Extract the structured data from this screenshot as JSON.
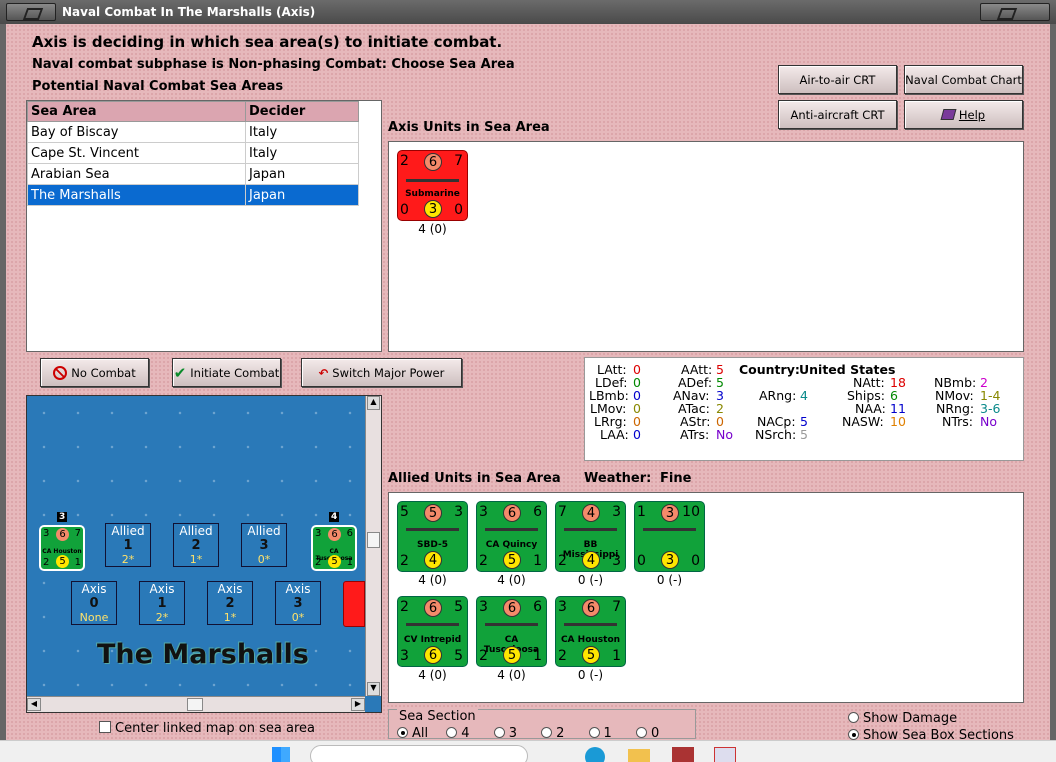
{
  "window": {
    "title": "Naval Combat In The Marshalls (Axis)"
  },
  "header": {
    "line1": "Axis is deciding in which sea area(s) to initiate combat.",
    "line2": "Naval combat subphase is Non-phasing Combat: Choose Sea Area",
    "line3": "Potential Naval Combat Sea Areas"
  },
  "buttons": {
    "air_to_air": "Air-to-air CRT",
    "naval_chart": "Naval Combat Chart",
    "anti_aircraft": "Anti-aircraft CRT",
    "help": "Help",
    "no_combat": "No Combat",
    "initiate": "Initiate Combat",
    "switch": "Switch Major Power"
  },
  "sea_table": {
    "headers": [
      "Sea Area",
      "Decider"
    ],
    "rows": [
      {
        "area": "Bay of Biscay",
        "decider": "Italy"
      },
      {
        "area": "Cape St. Vincent",
        "decider": "Italy"
      },
      {
        "area": "Arabian Sea",
        "decider": "Japan"
      },
      {
        "area": "The Marshalls",
        "decider": "Japan"
      }
    ]
  },
  "axis_units": {
    "label": "Axis Units in Sea Area",
    "sub": {
      "tl": "2",
      "tc": "6",
      "tr": "7",
      "name": "Submarine",
      "bl": "0",
      "bc": "3",
      "br": "0",
      "val": "4 (0)"
    }
  },
  "stats": {
    "country_label": "Country:",
    "country": "United States",
    "latt_l": "LAtt:",
    "latt": "0",
    "ldef_l": "LDef:",
    "ldef": "0",
    "lbmb_l": "LBmb:",
    "lbmb": "0",
    "lmov_l": "LMov:",
    "lmov": "0",
    "lrrg_l": "LRrg:",
    "lrrg": "0",
    "laa_l": "LAA:",
    "laa": "0",
    "aatt_l": "AAtt:",
    "aatt": "5",
    "adef_l": "ADef:",
    "adef": "5",
    "anav_l": "ANav:",
    "anav": "3",
    "atac_l": "ATac:",
    "atac": "2",
    "astr_l": "AStr:",
    "astr": "0",
    "atrs_l": "ATrs:",
    "atrs": "No",
    "arng_l": "ARng:",
    "arng": "4",
    "nacp_l": "NACp:",
    "nacp": "5",
    "nsrch_l": "NSrch:",
    "nsrch": "5",
    "natt_l": "NAtt:",
    "natt": "18",
    "ships_l": "Ships:",
    "ships": "6",
    "naa_l": "NAA:",
    "naa": "11",
    "nasw_l": "NASW:",
    "nasw": "10",
    "nbmb_l": "NBmb:",
    "nbmb": "2",
    "nmov_l": "NMov:",
    "nmov": "1-4",
    "nrng_l": "NRng:",
    "nrng": "3-6",
    "ntrs_l": "NTrs:",
    "ntrs": "No"
  },
  "allied": {
    "label": "Allied Units in Sea Area",
    "weather_label": "Weather:",
    "weather": "Fine",
    "units": [
      {
        "tl": "5",
        "tc": "5",
        "tr": "3",
        "name": "SBD-5",
        "bl": "2",
        "bc": "4",
        "br": "",
        "val": "4 (0)"
      },
      {
        "tl": "3",
        "tc": "6",
        "tr": "6",
        "name": "CA Quincy",
        "bl": "2",
        "bc": "5",
        "br": "1",
        "val": "4 (0)"
      },
      {
        "tl": "7",
        "tc": "4",
        "tr": "3",
        "name": "BB Mississippi",
        "bl": "2",
        "bc": "4",
        "br": "3",
        "val": "0 (-)"
      },
      {
        "tl": "1",
        "tc": "3",
        "tr": "10",
        "name": "",
        "bl": "0",
        "bc": "3",
        "br": "0",
        "val": "0 (-)"
      },
      {
        "tl": "2",
        "tc": "6",
        "tr": "5",
        "name": "CV Intrepid",
        "bl": "3",
        "bc": "6",
        "br": "5",
        "val": "4 (0)"
      },
      {
        "tl": "3",
        "tc": "6",
        "tr": "6",
        "name": "CA Tuscaloosa",
        "bl": "2",
        "bc": "5",
        "br": "1",
        "val": "4 (0)"
      },
      {
        "tl": "3",
        "tc": "6",
        "tr": "7",
        "name": "CA Houston",
        "bl": "2",
        "bc": "5",
        "br": "1",
        "val": "0 (-)"
      }
    ]
  },
  "map": {
    "name": "The Marshalls",
    "allied_boxes": [
      {
        "side": "Allied",
        "num": "1",
        "val": "2*"
      },
      {
        "side": "Allied",
        "num": "2",
        "val": "1*"
      },
      {
        "side": "Allied",
        "num": "3",
        "val": "0*"
      }
    ],
    "axis_boxes": [
      {
        "side": "Axis",
        "num": "0",
        "val": "None"
      },
      {
        "side": "Axis",
        "num": "1",
        "val": "2*"
      },
      {
        "side": "Axis",
        "num": "2",
        "val": "1*"
      },
      {
        "side": "Axis",
        "num": "3",
        "val": "0*"
      }
    ],
    "left_counter": {
      "tl": "3",
      "tc": "6",
      "tr": "7",
      "name": "CA Houston",
      "bl": "2",
      "bc": "5",
      "br": "1",
      "stack": "3"
    },
    "right_counter": {
      "tl": "3",
      "tc": "6",
      "tr": "6",
      "name": "CA Tuscaloosa",
      "bl": "2",
      "bc": "5",
      "br": "1",
      "stack": "4"
    }
  },
  "footer": {
    "center_map": "Center linked map on sea area",
    "sea_section": "Sea Section",
    "options": [
      "All",
      "4",
      "3",
      "2",
      "1",
      "0"
    ],
    "show_damage": "Show Damage",
    "show_sections": "Show Sea Box Sections"
  },
  "colors": {
    "selected": "#0a6ad0",
    "axis_counter": "#ff1a1a",
    "allied_counter": "#11a23a",
    "sea": "#2a79b8"
  }
}
